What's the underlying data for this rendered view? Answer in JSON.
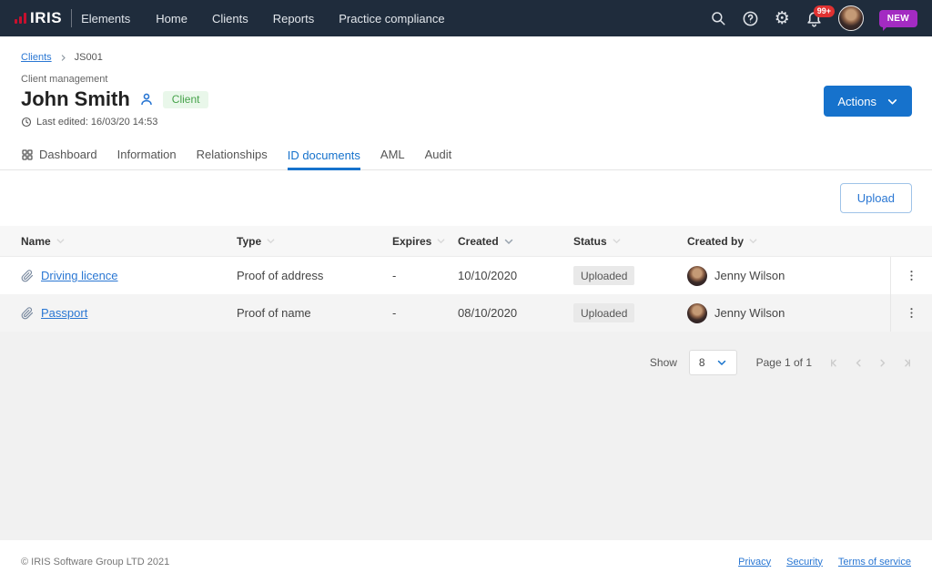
{
  "navbar": {
    "brand": "IRIS",
    "product": "Elements",
    "items": [
      {
        "label": "Home"
      },
      {
        "label": "Clients"
      },
      {
        "label": "Reports"
      },
      {
        "label": "Practice compliance"
      }
    ],
    "notification_count": "99+",
    "new_badge_label": "NEW",
    "icons": [
      "search-icon",
      "help-icon",
      "gear-icon",
      "bell-icon",
      "avatar"
    ]
  },
  "breadcrumb": {
    "link": "Clients",
    "current": "JS001"
  },
  "header": {
    "eyebrow": "Client management",
    "title": "John Smith",
    "badge": "Client",
    "last_edited": "Last edited: 16/03/20 14:53",
    "actions_label": "Actions"
  },
  "tabs": [
    {
      "label": "Dashboard",
      "active": false
    },
    {
      "label": "Information",
      "active": false
    },
    {
      "label": "Relationships",
      "active": false
    },
    {
      "label": "ID documents",
      "active": true
    },
    {
      "label": "AML",
      "active": false
    },
    {
      "label": "Audit",
      "active": false
    }
  ],
  "toolbar": {
    "upload_label": "Upload"
  },
  "table": {
    "columns": [
      {
        "label": "Name",
        "sorted": false
      },
      {
        "label": "Type",
        "sorted": false
      },
      {
        "label": "Expires",
        "sorted": false
      },
      {
        "label": "Created",
        "sorted": true
      },
      {
        "label": "Status",
        "sorted": false
      },
      {
        "label": "Created by",
        "sorted": false
      }
    ],
    "rows": [
      {
        "name": "Driving licence",
        "type": "Proof of address",
        "expires": "-",
        "created": "10/10/2020",
        "status": "Uploaded",
        "created_by": "Jenny Wilson"
      },
      {
        "name": "Passport",
        "type": "Proof of name",
        "expires": "-",
        "created": "08/10/2020",
        "status": "Uploaded",
        "created_by": "Jenny Wilson"
      }
    ]
  },
  "pagination": {
    "show_label": "Show",
    "page_size": "8",
    "page_info": "Page 1 of 1"
  },
  "footer": {
    "copyright": "© IRIS Software Group LTD 2021",
    "links": [
      {
        "label": "Privacy"
      },
      {
        "label": "Security"
      },
      {
        "label": "Terms of service"
      }
    ]
  },
  "colors": {
    "navbar_bg": "#1f2c3c",
    "accent_blue": "#1672cc",
    "link_blue": "#2a77d3",
    "brand_red": "#c8102e",
    "badge_green_bg": "#e9f7ea",
    "badge_green_text": "#46a24a",
    "new_badge_purple": "#a32bc2",
    "notification_red": "#e03131",
    "status_badge_bg": "#e9e9e9"
  }
}
